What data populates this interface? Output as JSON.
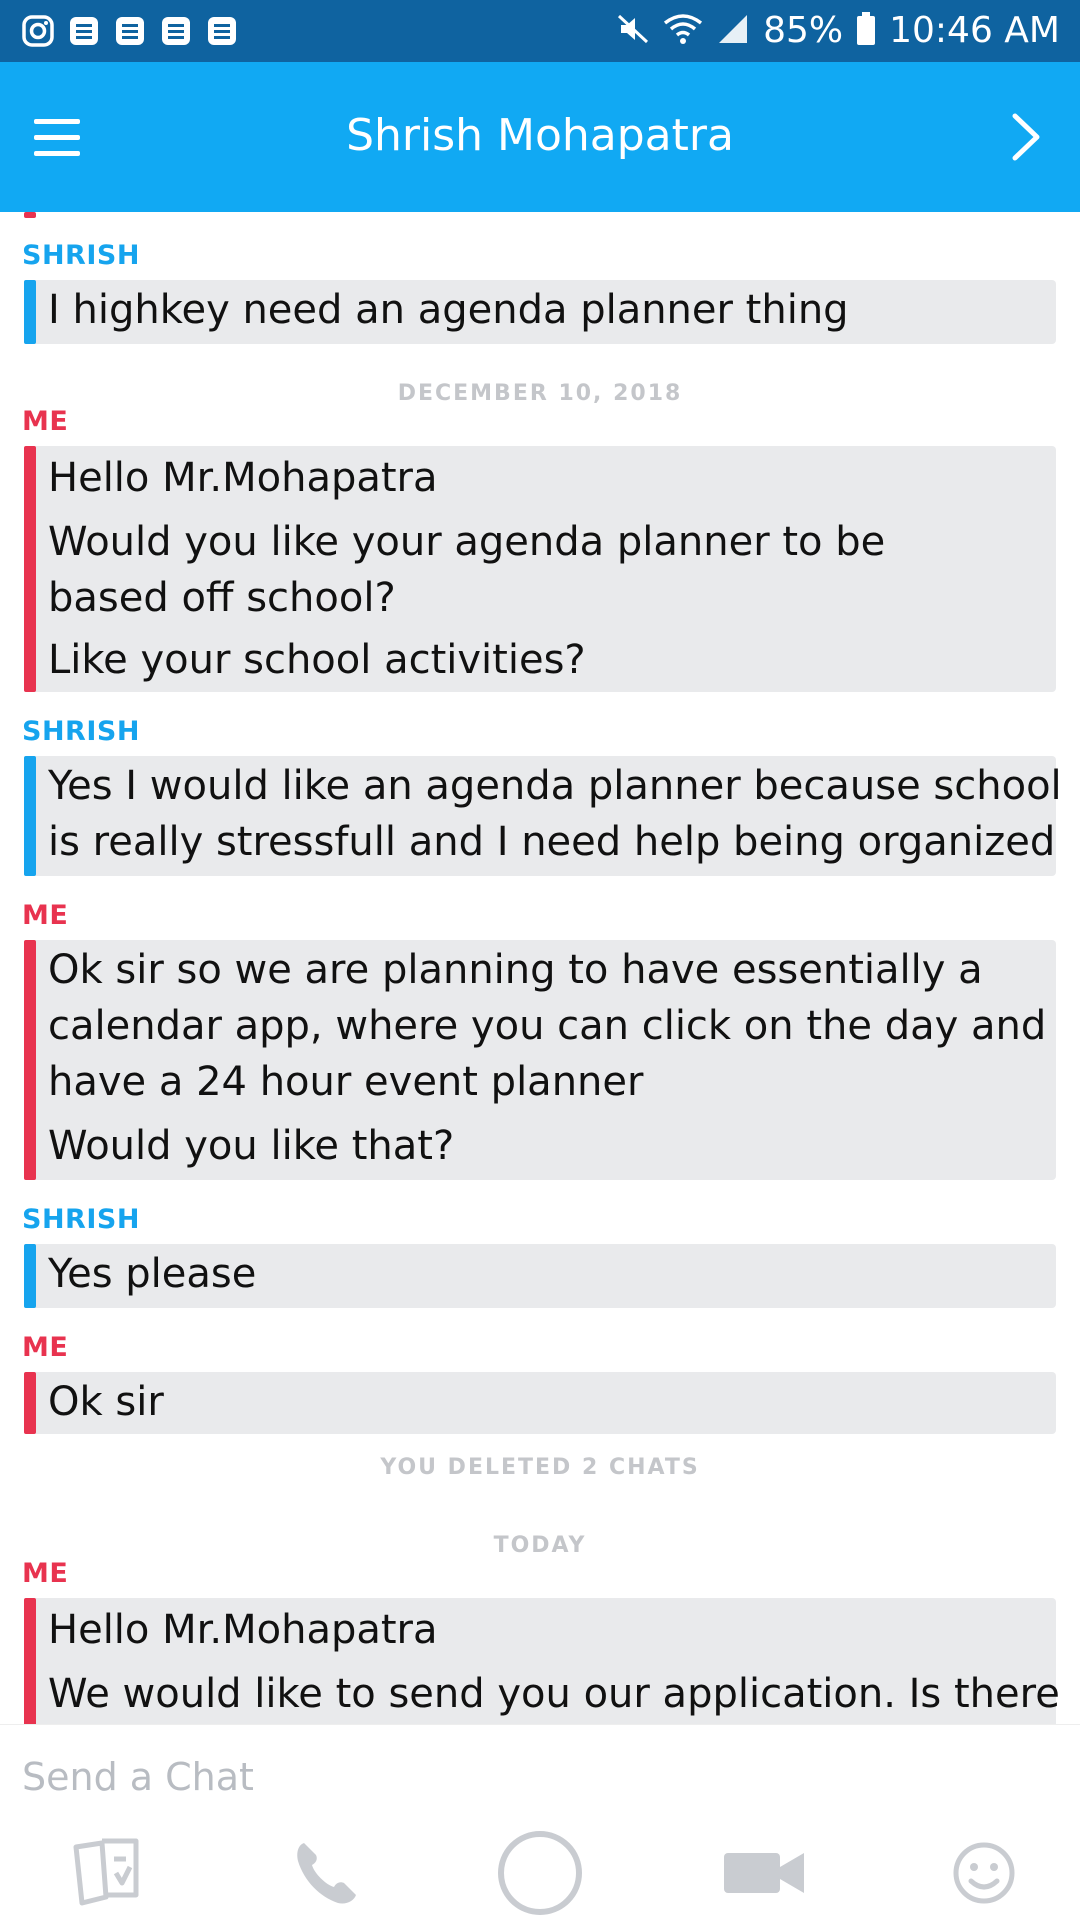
{
  "status_bar": {
    "battery_percent": "85%",
    "time": "10:46 AM",
    "icons": [
      "instagram-icon",
      "notification-icon",
      "notification-icon",
      "notification-icon",
      "notification-icon",
      "mute-icon",
      "wifi-icon",
      "signal-icon",
      "battery-icon"
    ]
  },
  "header": {
    "title": "Shrish Mohapatra",
    "left_icon": "menu-icon",
    "right_icon": "chevron-right-icon",
    "background_color": "#11a9f3"
  },
  "colors": {
    "me": "#e8334f",
    "them": "#16a4ee",
    "bubble": "#e9eaec",
    "divider_text": "#c4c6ca"
  },
  "conversation": [
    {
      "kind": "message",
      "sender_label": "SHRISH",
      "from": "them",
      "lines": [
        "I highkey need an agenda planner thing"
      ]
    },
    {
      "kind": "divider",
      "text": "DECEMBER 10, 2018"
    },
    {
      "kind": "message",
      "sender_label": "ME",
      "from": "me",
      "lines": [
        "Hello Mr.Mohapatra",
        "Would you like your agenda planner to be",
        "based off school?",
        "Like your school activities?"
      ]
    },
    {
      "kind": "message",
      "sender_label": "SHRISH",
      "from": "them",
      "lines": [
        "Yes I would like an agenda planner because school",
        "is really stressfull and I need help being organized"
      ]
    },
    {
      "kind": "message",
      "sender_label": "ME",
      "from": "me",
      "lines": [
        "Ok sir so we are planning to have essentially a",
        "calendar app, where you can click on the day and",
        "have a 24 hour event planner",
        "Would you like that?"
      ]
    },
    {
      "kind": "message",
      "sender_label": "SHRISH",
      "from": "them",
      "lines": [
        "Yes please"
      ]
    },
    {
      "kind": "message",
      "sender_label": "ME",
      "from": "me",
      "lines": [
        "Ok sir"
      ]
    },
    {
      "kind": "divider",
      "text": "YOU DELETED 2 CHATS"
    },
    {
      "kind": "divider",
      "text": "TODAY"
    },
    {
      "kind": "message",
      "sender_label": "ME",
      "from": "me",
      "lines": [
        "Hello Mr.Mohapatra",
        "We would like to send you our application. Is there"
      ]
    }
  ],
  "input": {
    "placeholder": "Send a Chat",
    "value": ""
  },
  "toolbar": {
    "buttons": [
      "memories-icon",
      "phone-icon",
      "capture-icon",
      "video-icon",
      "emoji-icon"
    ]
  }
}
